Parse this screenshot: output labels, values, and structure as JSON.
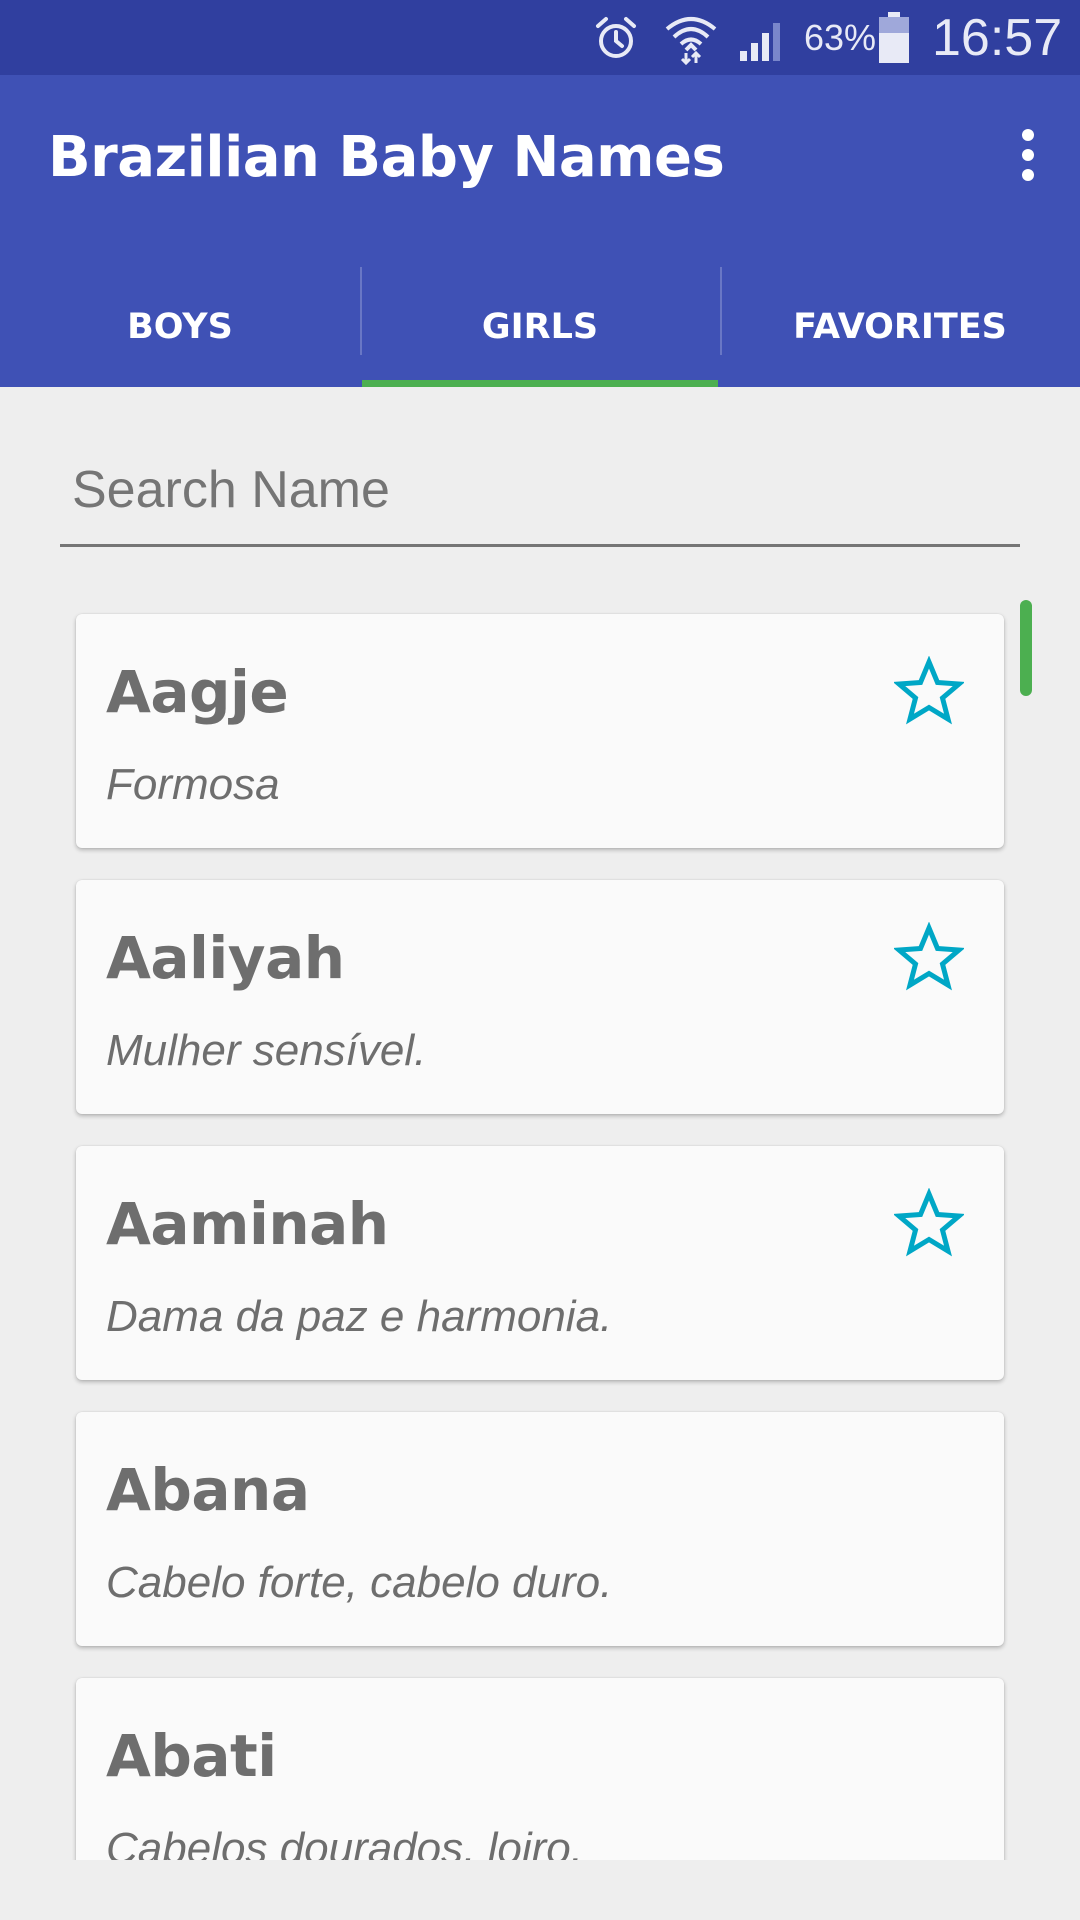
{
  "status_bar": {
    "battery_percent": "63%",
    "time": "16:57",
    "icons": [
      "alarm-icon",
      "wifi-icon",
      "signal-icon",
      "battery-icon"
    ]
  },
  "app_bar": {
    "title": "Brazilian Baby Names",
    "overflow_icon": "more-vert-icon",
    "background_color": "#3F51B5",
    "status_color": "#303F9F"
  },
  "tabs": [
    {
      "label": "BOYS",
      "active": false
    },
    {
      "label": "GIRLS",
      "active": true
    },
    {
      "label": "FAVORITES",
      "active": false
    }
  ],
  "tab_indicator_color": "#4CAF50",
  "search": {
    "placeholder": "Search Name",
    "value": ""
  },
  "star_color": "#00A7C6",
  "names": [
    {
      "name": "Aagje",
      "meaning": "Formosa",
      "favorite_icon": true
    },
    {
      "name": "Aaliyah",
      "meaning": "Mulher sensível.",
      "favorite_icon": true
    },
    {
      "name": "Aaminah",
      "meaning": "Dama da paz e harmonia.",
      "favorite_icon": true
    },
    {
      "name": "Abana",
      "meaning": "Cabelo forte, cabelo duro.",
      "favorite_icon": false
    },
    {
      "name": "Abati",
      "meaning": "Cabelos dourados, loiro.",
      "favorite_icon": false
    }
  ]
}
